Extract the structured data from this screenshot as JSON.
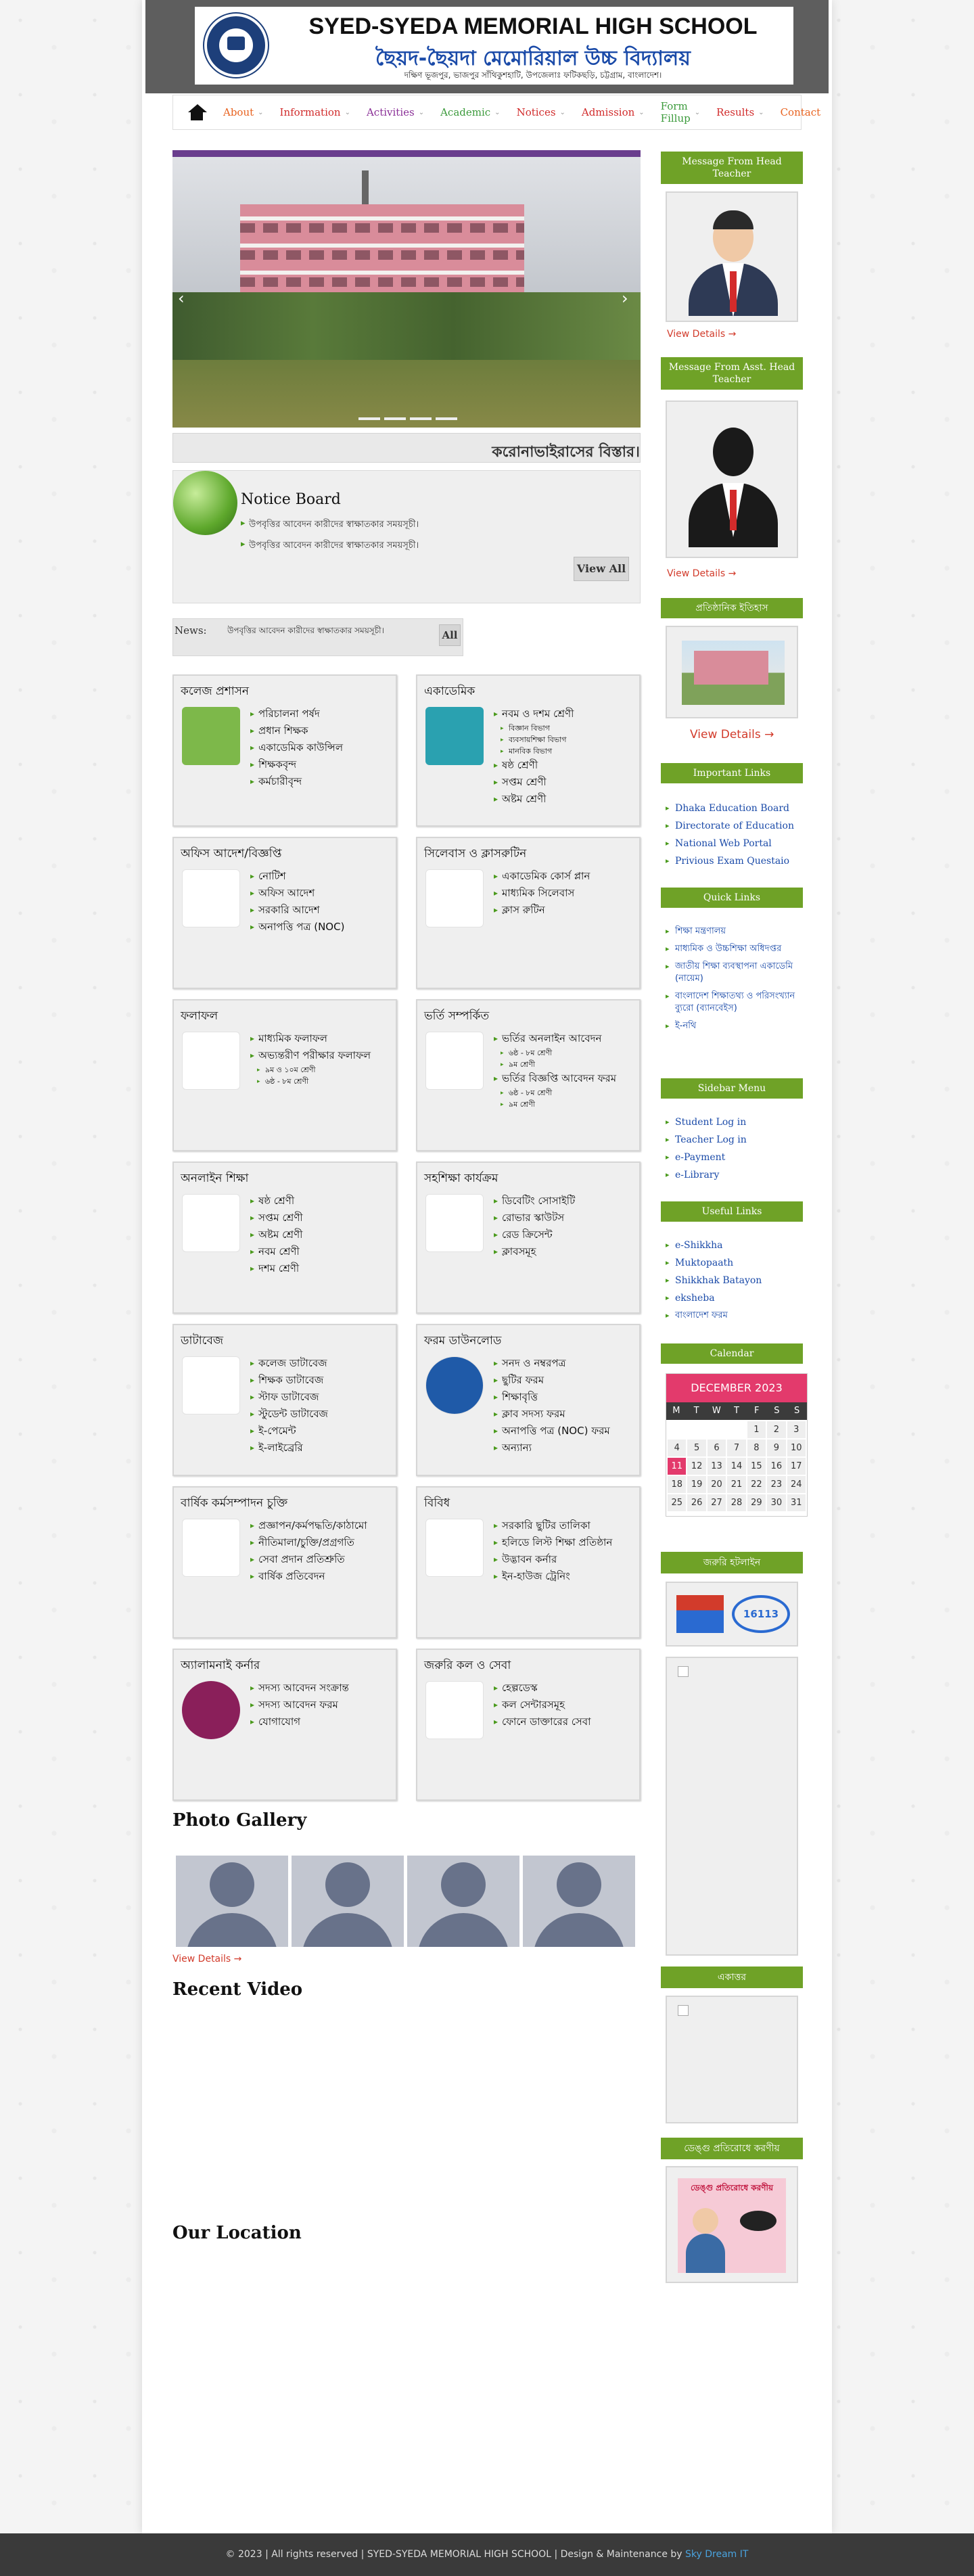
{
  "header": {
    "school_en": "SYED-SYEDA MEMORIAL HIGH SCHOOL",
    "school_bn": "ছৈয়দ-ছৈয়দা মেমোরিয়াল উচ্চ বিদ্যালয়",
    "address": "দক্ষিণ ভূজপুর, ভাজপুর সাঁথিকুশহাটি, উপজেলাঃ ফটিকছড়ি, চট্টগ্রাম, বাংলাদেশ।"
  },
  "nav": {
    "items": [
      {
        "label": "About",
        "color": "#e8621f"
      },
      {
        "label": "Information",
        "color": "#d12b2b"
      },
      {
        "label": "Activities",
        "color": "#8a2f97"
      },
      {
        "label": "Academic",
        "color": "#3b9a3b"
      },
      {
        "label": "Notices",
        "color": "#d12b2b"
      },
      {
        "label": "Admission",
        "color": "#d12b2b"
      },
      {
        "label": "Form Fillup",
        "color": "#3b9a3b"
      },
      {
        "label": "Results",
        "color": "#d12b2b"
      },
      {
        "label": "Contact",
        "color": "#e8621f"
      }
    ]
  },
  "marquee": "করোনাভাইরাসের বিস্তার।",
  "notice": {
    "title": "Notice Board",
    "items": [
      "উপবৃত্তির আবেদন কারীদের স্বাক্ষাতকার সময়সূচী।",
      "উপবৃত্তির আবেদন কারীদের স্বাক্ষাতকার সময়সূচী।"
    ],
    "view_all": "View All"
  },
  "news": {
    "label": "News:",
    "text": "উপবৃত্তির আবেদন কারীদের স্বাক্ষাতকার সময়সূচী।",
    "all": "All"
  },
  "boxes": [
    {
      "title": "কলেজ প্রশাসন",
      "items": [
        "পরিচালনা পর্ষদ",
        "প্রধান শিক্ষক",
        "একাডেমিক কাউন্সিল",
        "শিক্ষকবৃন্দ",
        "কর্মচারীবৃন্দ"
      ]
    },
    {
      "title": "একাডেমিক",
      "items": [
        "নবম ও দশম শ্রেণী",
        "বিজ্ঞান বিভাগ",
        "ব্যবসায়শিক্ষা বিভাগ",
        "মানবিক বিভাগ",
        "ষষ্ঠ শ্রেণী",
        "সপ্তম শ্রেণী",
        "অষ্টম শ্রেণী"
      ]
    },
    {
      "title": "অফিস আদেশ/বিজ্ঞপ্তি",
      "items": [
        "নোটিশ",
        "অফিস আদেশ",
        "সরকারি আদেশ",
        "অনাপত্তি পত্র (NOC)"
      ]
    },
    {
      "title": "সিলেবাস ও ক্লাসরুটিন",
      "items": [
        "একাডেমিক কোর্স প্লান",
        "মাধ্যমিক সিলেবাস",
        "ক্লাস রুটিন"
      ]
    },
    {
      "title": "ফলাফল",
      "items": [
        "মাধ্যমিক ফলাফল",
        "অভ্যন্তরীণ পরীক্ষার ফলাফল",
        "৯ম ও ১০ম শ্রেণী",
        "৬ষ্ঠ - ৮ম শ্রেণী"
      ]
    },
    {
      "title": "ভর্তি সম্পর্কিত",
      "items": [
        "ভর্তির অনলাইন আবেদন",
        "৬ষ্ঠ - ৮ম শ্রেণী",
        "৯ম শ্রেণী",
        "ভর্তির বিজ্ঞপ্তি আবেদন ফরম",
        "৬ষ্ঠ - ৮ম শ্রেণী",
        "৯ম শ্রেণী"
      ]
    },
    {
      "title": "অনলাইন শিক্ষা",
      "items": [
        "ষষ্ঠ শ্রেণী",
        "সপ্তম শ্রেণী",
        "অষ্টম শ্রেণী",
        "নবম শ্রেণী",
        "দশম শ্রেণী"
      ]
    },
    {
      "title": "সহশিক্ষা কার্যক্রম",
      "items": [
        "ডিবেটিং সোসাইটি",
        "রোভার স্কাউটস",
        "রেড ক্রিসেন্ট",
        "ক্লাবসমূহ"
      ]
    },
    {
      "title": "ডাটাবেজ",
      "items": [
        "কলেজ ডাটাবেজ",
        "শিক্ষক ডাটাবেজ",
        "স্টাফ ডাটাবেজ",
        "স্টুডেন্ট ডাটাবেজ",
        "ই-পেমেন্ট",
        "ই-লাইব্রেরি"
      ]
    },
    {
      "title": "ফরম ডাউনলোড",
      "items": [
        "সনদ ও নম্বরপত্র",
        "ছুটির ফরম",
        "শিক্ষাবৃত্তি",
        "ক্লাব সদস্য ফরম",
        "অনাপত্তি পত্র (NOC) ফরম",
        "অন্যান্য"
      ]
    },
    {
      "title": "বার্ষিক কর্মসম্পাদন চুক্তি",
      "items": [
        "প্রজ্ঞাপন/কর্মপদ্ধতি/কাঠামো",
        "নীতিমালা/চুক্তি/প্রগ্রগতি",
        "সেবা প্রদান প্রতিশ্রুতি",
        "বার্ষিক প্রতিবেদন"
      ]
    },
    {
      "title": "বিবিধ",
      "items": [
        "সরকারি ছুটির তালিকা",
        "হলিডে লিস্ট শিক্ষা প্রতিষ্ঠান",
        "উদ্ভাবন কর্নার",
        "ইন-হাউজ ট্রেনিং"
      ]
    },
    {
      "title": "অ্যালামনাই কর্নার",
      "items": [
        "সদস্য আবেদন সংক্রান্ত",
        "সদস্য আবেদন ফরম",
        "যোগাযোগ"
      ]
    },
    {
      "title": "জরুরি কল ও সেবা",
      "items": [
        "হেল্পডেস্ক",
        "কল সেন্টারসমূহ",
        "ফোনে ডাক্তারের সেবা"
      ]
    }
  ],
  "sidebar": {
    "head_teacher": "Message From Head Teacher",
    "asst_head": "Message From Asst. Head Teacher",
    "history": "প্রতিষ্ঠানিক ইতিহাস",
    "view_details": "View Details →",
    "view_details_big": "View Details →",
    "important_links": {
      "title": "Important Links",
      "items": [
        "Dhaka Education Board",
        "Directorate of Education",
        "National Web Portal",
        "Privious Exam Questaio"
      ]
    },
    "quick_links": {
      "title": "Quick Links",
      "items": [
        "শিক্ষা মন্ত্রণালয়",
        "মাধ্যমিক ও উচ্চশিক্ষা অধিদপ্তর",
        "জাতীয় শিক্ষা ব্যবস্থাপনা একাডেমি (নায়েম)",
        "বাংলাদেশ শিক্ষাতথ্য ও পরিসংখ্যান ব্যুরো (ব্যানবেইস)",
        "ই-নথি"
      ]
    },
    "sidebar_menu": {
      "title": "Sidebar Menu",
      "items": [
        "Student Log in",
        "Teacher Log in",
        "e-Payment",
        "e-Library"
      ]
    },
    "useful_links": {
      "title": "Useful Links",
      "items": [
        "e-Shikkha",
        "Muktopaath",
        "Shikkhak Batayon",
        "eksheba",
        "বাংলাদেশ ফরম"
      ]
    },
    "calendar": {
      "title": "Calendar",
      "month": "DECEMBER 2023",
      "days": [
        "M",
        "T",
        "W",
        "T",
        "F",
        "S",
        "S"
      ],
      "cells": [
        "",
        "",
        "",
        "",
        "1",
        "2",
        "3",
        "4",
        "5",
        "6",
        "7",
        "8",
        "9",
        "10",
        "11",
        "12",
        "13",
        "14",
        "15",
        "16",
        "17",
        "18",
        "19",
        "20",
        "21",
        "22",
        "23",
        "24",
        "25",
        "26",
        "27",
        "28",
        "29",
        "30",
        "31"
      ],
      "today": "11"
    },
    "hotline": "জরুরি হটলাইন",
    "hotline_number": "16113",
    "ekattor": "একাত্তর",
    "dengue": "ডেঙ্গু প্রতিরোধে করণীয়",
    "dengue_img_text": "ডেঙ্গু প্রতিরোধে করণীয়"
  },
  "gallery": {
    "title": "Photo Gallery",
    "view_details": "View Details →"
  },
  "video": {
    "title": "Recent Video"
  },
  "location": {
    "title": "Our Location"
  },
  "footer": {
    "text": "© 2023 | All rights reserved | SYED-SYEDA MEMORIAL HIGH SCHOOL | Design & Maintenance by",
    "brand": "Sky Dream IT"
  }
}
